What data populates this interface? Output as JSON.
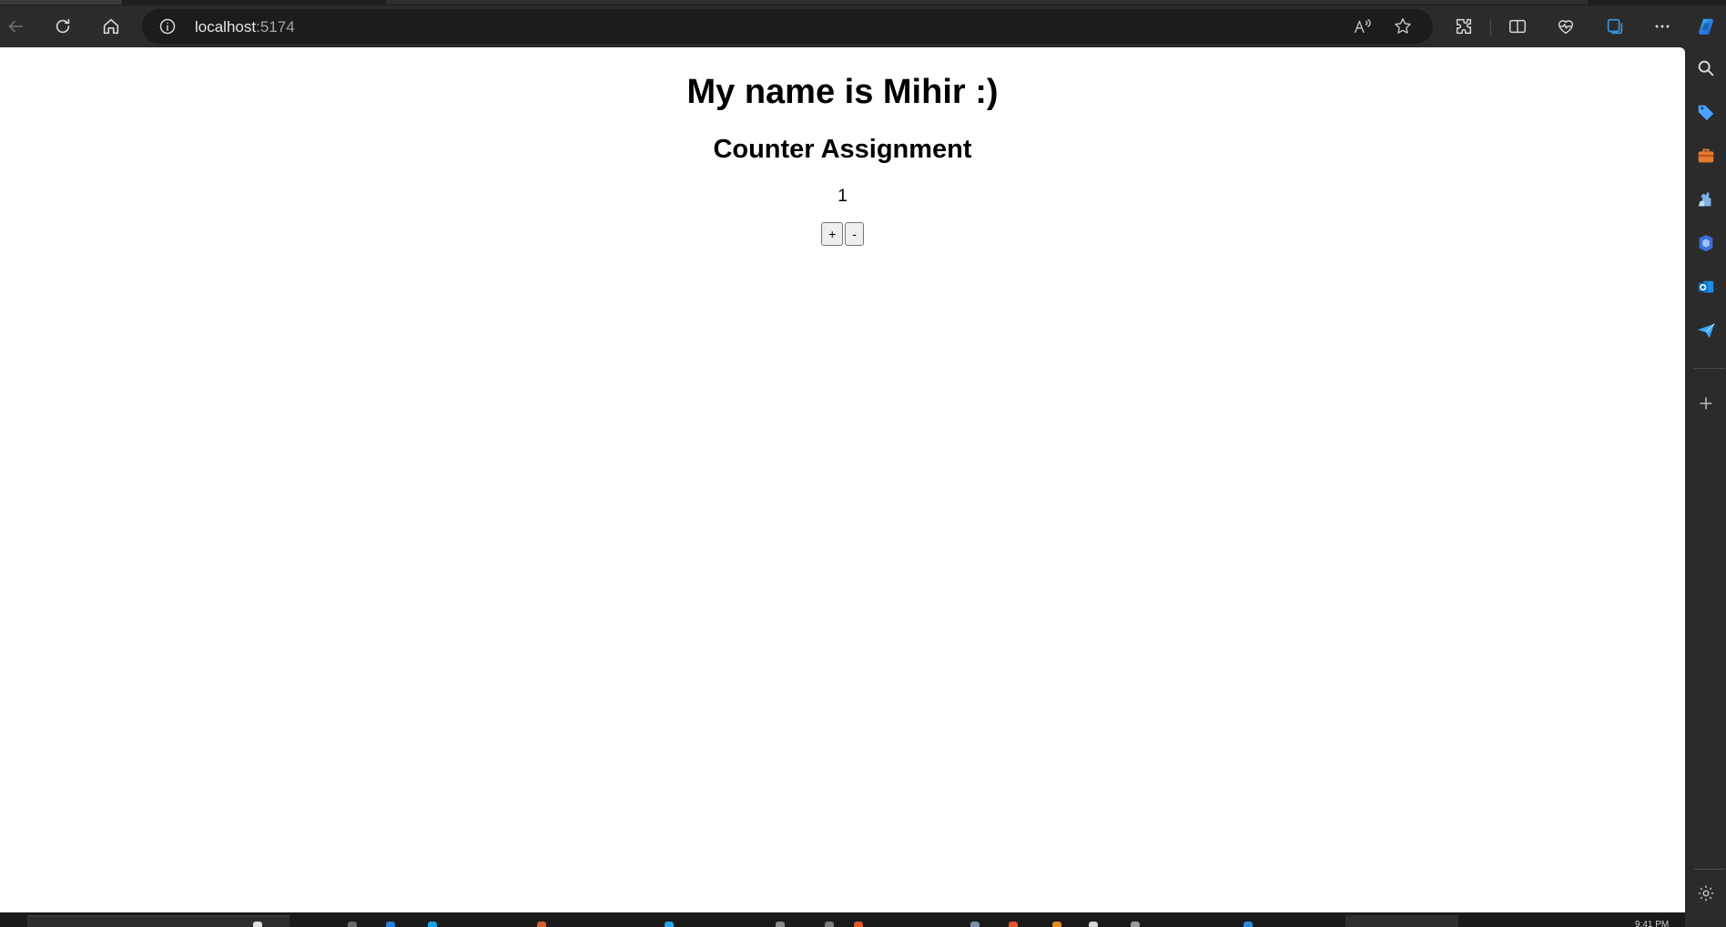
{
  "browser": {
    "url_host": "localhost",
    "url_port": ":5174",
    "icons": {
      "back": "back-arrow-icon",
      "reload": "reload-icon",
      "home": "home-icon",
      "site_info": "info-icon",
      "read_aloud": "read-aloud-icon",
      "favorite": "star-icon",
      "extensions": "puzzle-icon",
      "split_screen": "split-screen-icon",
      "browser_essentials": "heart-pulse-icon",
      "collections": "collections-icon",
      "more": "ellipsis-icon",
      "copilot": "copilot-icon"
    }
  },
  "page": {
    "title": "My name is Mihir :)",
    "subtitle": "Counter Assignment",
    "count": "1",
    "increment_label": "+",
    "decrement_label": "-"
  },
  "sidebar": {
    "icons": [
      "search-icon",
      "tag-icon",
      "briefcase-icon",
      "games-icon",
      "office-icon",
      "outlook-icon",
      "send-icon",
      "add-icon",
      "settings-icon"
    ]
  },
  "taskbar": {
    "clock": "9:41 PM"
  }
}
